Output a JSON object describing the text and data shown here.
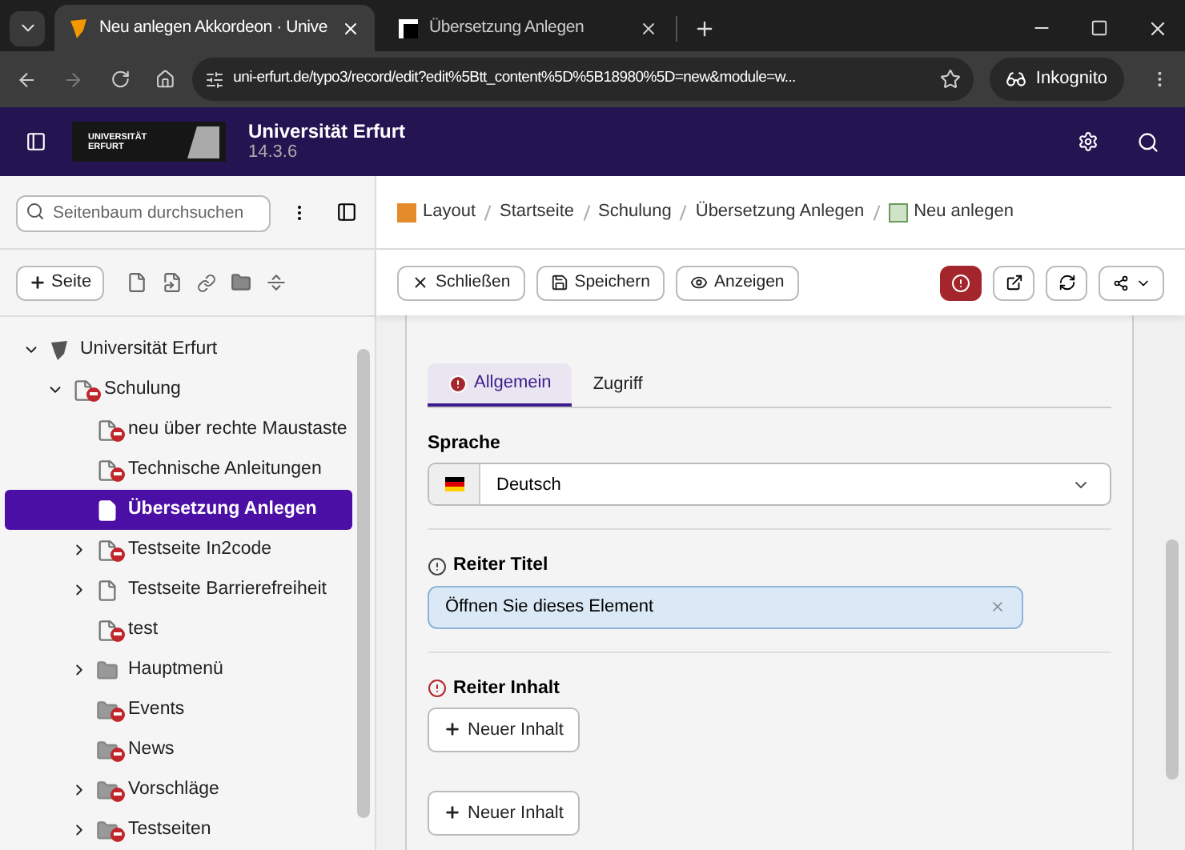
{
  "browser": {
    "tabs": [
      {
        "title": "Neu anlegen Akkordeon · Unive",
        "selected": true
      },
      {
        "title": "Übersetzung Anlegen",
        "selected": false
      }
    ],
    "url": "uni-erfurt.de/typo3/record/edit?edit%5Btt_content%5D%5B18980%5D=new&module=w...",
    "profile": "Inkognito"
  },
  "header": {
    "logo_text": "UNIVERSITÄT ERFURT",
    "site_name": "Universität Erfurt",
    "version": "14.3.6"
  },
  "sidebar": {
    "search": {
      "placeholder": "Seitenbaum durchsuchen"
    },
    "new_page_button": "Seite",
    "tree": [
      {
        "label": "Universität Erfurt",
        "kind": "root",
        "expanded": true,
        "selected": false,
        "children": [
          {
            "label": "Schulung",
            "kind": "page-restricted",
            "expanded": true,
            "selected": false,
            "children": [
              {
                "label": "neu über rechte Maustaste",
                "kind": "page-restricted",
                "selected": false
              },
              {
                "label": "Technische Anleitungen",
                "kind": "page-restricted",
                "selected": false
              },
              {
                "label": "Übersetzung Anlegen",
                "kind": "page",
                "selected": true
              },
              {
                "label": "Testseite In2code",
                "kind": "page-restricted",
                "expanded": false,
                "selected": false
              },
              {
                "label": "Testseite Barrierefreiheit",
                "kind": "page",
                "expanded": false,
                "selected": false
              },
              {
                "label": "test",
                "kind": "page-restricted",
                "selected": false
              },
              {
                "label": "Hauptmenü",
                "kind": "folder",
                "expanded": false,
                "selected": false
              },
              {
                "label": "Events",
                "kind": "folder-restricted",
                "selected": false
              },
              {
                "label": "News",
                "kind": "folder-restricted",
                "selected": false
              },
              {
                "label": "Vorschläge",
                "kind": "folder-restricted",
                "expanded": false,
                "selected": false
              },
              {
                "label": "Testseiten",
                "kind": "folder-restricted",
                "expanded": false,
                "selected": false
              }
            ]
          }
        ]
      }
    ]
  },
  "breadcrumb": [
    "Layout",
    "Startseite",
    "Schulung",
    "Übersetzung Anlegen",
    "Neu anlegen"
  ],
  "toolbar": {
    "buttons": [
      "Schließen",
      "Speichern",
      "Anzeigen"
    ]
  },
  "form": {
    "tabs": [
      {
        "label": "Allgemein",
        "selected": true,
        "error": true
      },
      {
        "label": "Zugriff",
        "selected": false,
        "error": false
      }
    ],
    "fields": [
      {
        "kind": "select",
        "label": "Sprache",
        "value": "Deutsch"
      },
      {
        "kind": "text",
        "label": "Reiter Titel",
        "error": false,
        "value": "Öffnen Sie dieses Element"
      },
      {
        "kind": "inline",
        "label": "Reiter Inhalt",
        "error": true,
        "button": "Neuer Inhalt"
      },
      {
        "kind": "button",
        "button": "Neuer Inhalt"
      }
    ]
  }
}
